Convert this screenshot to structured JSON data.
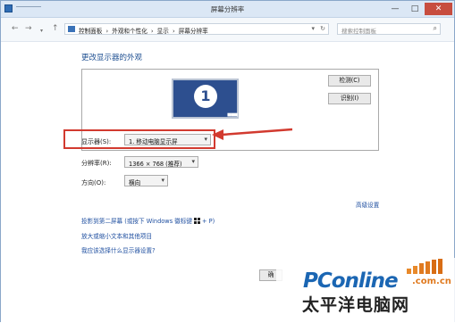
{
  "window": {
    "title": "屏幕分辨率",
    "controls": {
      "minimize": "—",
      "maximize": "□",
      "close": "✕"
    }
  },
  "nav": {
    "breadcrumbs": [
      "控制面板",
      "›",
      "外观和个性化",
      "›",
      "显示",
      "›",
      "屏幕分辨率"
    ],
    "search_placeholder": "搜索控制面板"
  },
  "main": {
    "heading": "更改显示器的外观",
    "monitor_number": "1",
    "monitor_dots": "■■■",
    "detect_button": "检测(C)",
    "identify_button": "识别(I)",
    "display_label": "显示器(S):",
    "display_value": "1. 移动电脑显示屏",
    "resolution_label": "分辨率(R):",
    "resolution_value": "1366 × 768 (推荐)",
    "orientation_label": "方向(O):",
    "orientation_value": "横向",
    "advanced_link": "高级设置",
    "project_link_prefix": "投影到第二屏幕 (或按下 Windows 徽标键",
    "project_link_suffix": "+ P)",
    "text_size_link": "放大或缩小文本和其他项目",
    "help_link": "我应该选择什么显示器设置?",
    "ok_button": "确"
  },
  "watermark": {
    "brand": "PConline",
    "domain": ".com.cn",
    "chinese": "太平洋电脑网"
  },
  "colors": {
    "accent": "#1e4f91",
    "link": "#1f4fa0",
    "highlight": "#d23a2f",
    "monitor": "#2d4f8f"
  }
}
